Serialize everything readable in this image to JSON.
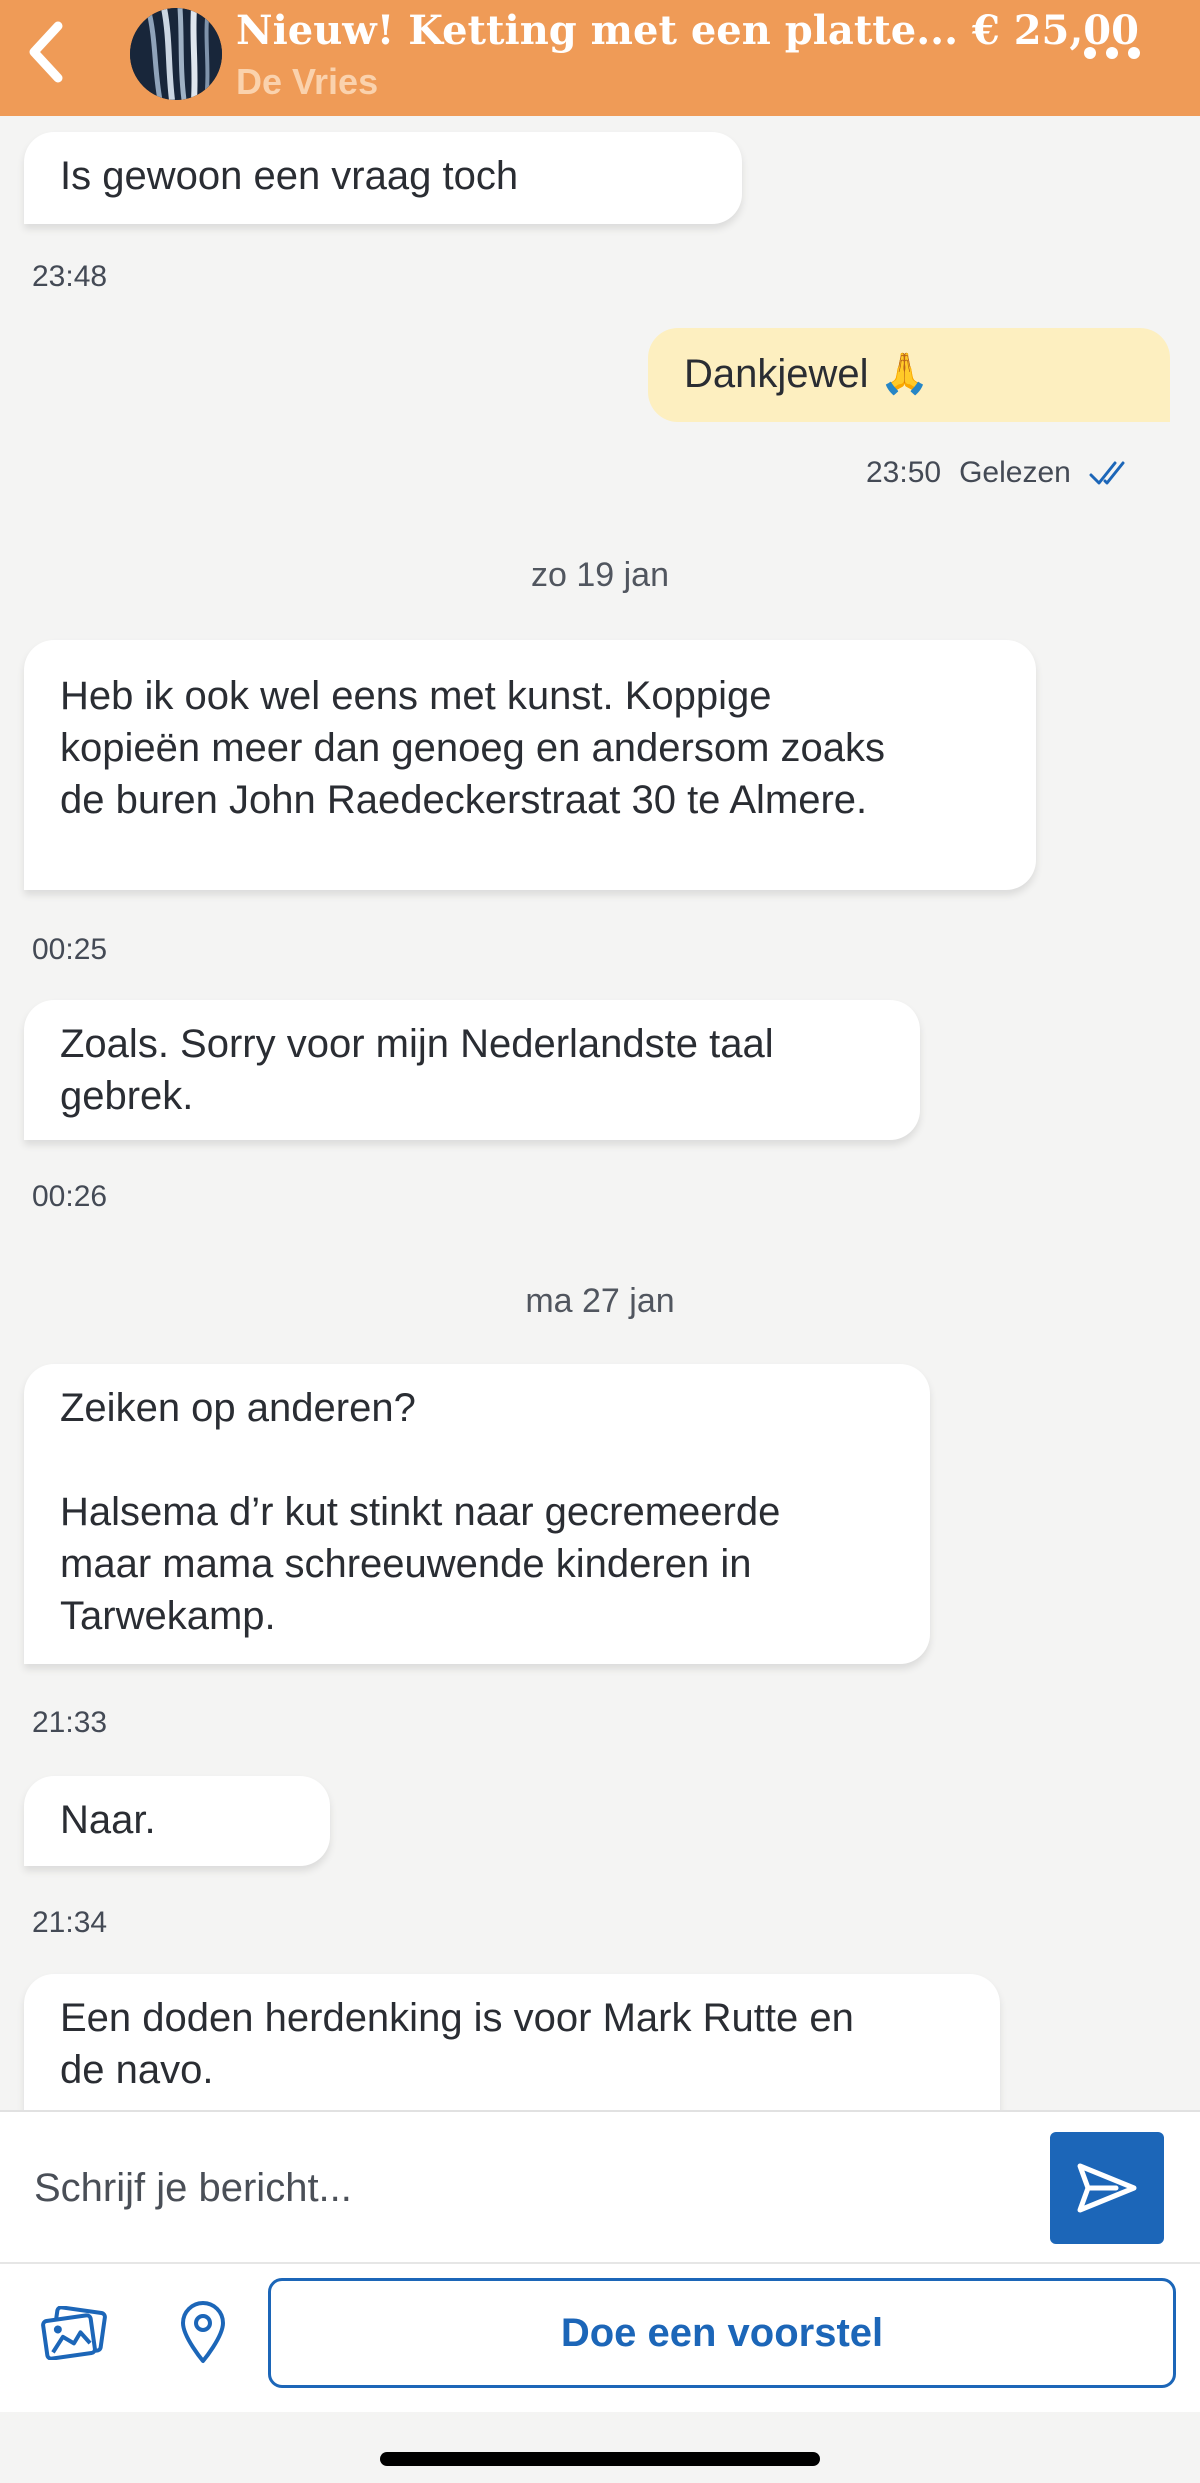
{
  "header": {
    "title": "Nieuw! Ketting met een platte... € 25,00",
    "seller": "De Vries",
    "icons": {
      "back": "chevron-left-icon",
      "more": "more-dots-icon"
    },
    "colors": {
      "bar": "#ef9b57"
    }
  },
  "messages": [
    {
      "type": "in",
      "text": "Is gewoon een vraag toch"
    },
    {
      "type": "time",
      "text": "23:48"
    },
    {
      "type": "out",
      "text": "Dankjewel 🙏"
    },
    {
      "type": "status",
      "time": "23:50",
      "label": "Gelezen"
    },
    {
      "type": "date",
      "text": "zo 19 jan"
    },
    {
      "type": "in",
      "text": "Heb ik ook wel eens met kunst. Koppige\nkopieën meer dan genoeg en andersom zoaks\nde buren John Raedeckerstraat 30 te Almere."
    },
    {
      "type": "time",
      "text": "00:25"
    },
    {
      "type": "in",
      "text": "Zoals. Sorry voor mijn Nederlandste taal\ngebrek."
    },
    {
      "type": "time",
      "text": "00:26"
    },
    {
      "type": "date",
      "text": "ma 27 jan"
    },
    {
      "type": "in",
      "text": "Zeiken op anderen?\n\nHalsema d’r kut stinkt naar gecremeerde\nmaar mama schreeuwende kinderen in\nTarwekamp."
    },
    {
      "type": "time",
      "text": "21:33"
    },
    {
      "type": "in",
      "text": "Naar."
    },
    {
      "type": "time",
      "text": "21:34"
    },
    {
      "type": "in",
      "text": "Een doden herdenking is voor Mark Rutte en\nde navo."
    }
  ],
  "composer": {
    "placeholder": "Schrijf je bericht...",
    "send_icon": "send-icon"
  },
  "actions": {
    "photo_icon": "photo-icon",
    "location_icon": "location-pin-icon",
    "offer_label": "Doe een voorstel"
  },
  "colors": {
    "accent": "#1c66b8",
    "outgoing_bubble": "#fdefc0",
    "incoming_bubble": "#ffffff",
    "read_check": "#1c66b8"
  }
}
